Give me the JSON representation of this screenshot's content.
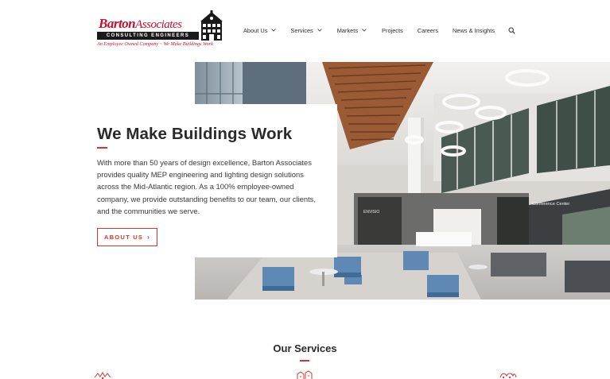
{
  "brand": {
    "name_bold": "Barton",
    "name_light": "Associates",
    "subtitle": "CONSULTING ENGINEERS",
    "tagline": "An Employee Owned Company ~ We Make Buildings Work",
    "primary_color": "#c8102e",
    "accent_color": "#d9352a"
  },
  "nav": {
    "items": [
      {
        "label": "About Us",
        "has_dropdown": true
      },
      {
        "label": "Services",
        "has_dropdown": true
      },
      {
        "label": "Markets",
        "has_dropdown": true
      },
      {
        "label": "Projects",
        "has_dropdown": false
      },
      {
        "label": "Careers",
        "has_dropdown": false
      },
      {
        "label": "News & Insights",
        "has_dropdown": false
      }
    ],
    "search_icon": "search-icon",
    "dropdown_icon": "chevron-down-icon"
  },
  "hero": {
    "title": "We Make Buildings Work",
    "body": "With more than 50 years of design excellence, Barton Associates provides quality MEP engineering and lighting design solutions across the Mid-Atlantic region. As a 100% employee-owned company, we provide outstanding benefits to our team, our clients, and the communities we serve.",
    "button_label": "ABOUT US",
    "button_icon": "chevron-right-icon",
    "image_signs": [
      "Conference Center"
    ]
  },
  "services": {
    "title": "Our Services",
    "icons": [
      "lighting-icon",
      "mep-icon",
      "systems-icon"
    ]
  }
}
